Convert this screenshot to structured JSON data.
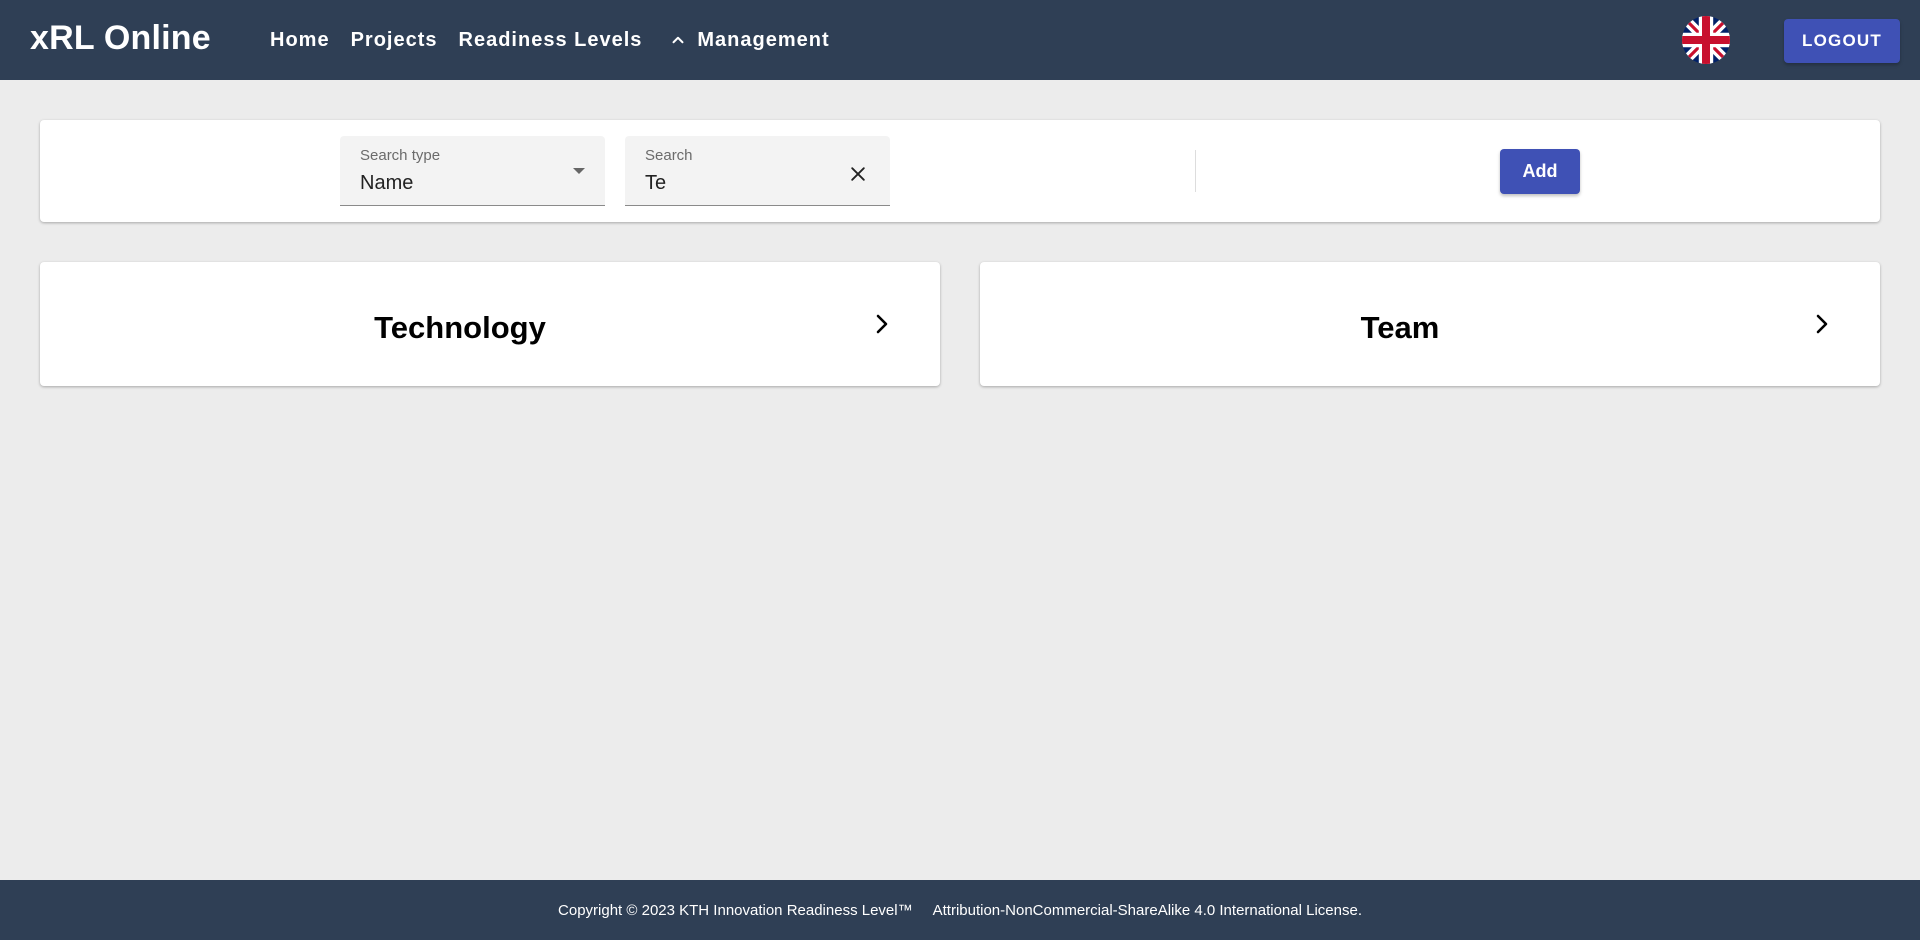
{
  "header": {
    "brand": "xRL Online",
    "nav": [
      {
        "label": "Home"
      },
      {
        "label": "Projects"
      },
      {
        "label": "Readiness Levels"
      },
      {
        "label": "Management",
        "icon": "chevron-up-icon"
      }
    ],
    "language_icon": "uk-flag-icon",
    "logout_label": "LOGOUT"
  },
  "search": {
    "type_label": "Search type",
    "type_value": "Name",
    "query_label": "Search",
    "query_value": "Te",
    "add_label": "Add"
  },
  "results": [
    {
      "title": "Technology",
      "icon": "chevron-right-icon"
    },
    {
      "title": "Team",
      "icon": "chevron-right-icon"
    }
  ],
  "footer": {
    "copyright": "Copyright © 2023 KTH Innovation Readiness Level™",
    "license": "Attribution-NonCommercial-ShareAlike 4.0 International License."
  },
  "colors": {
    "header_bg": "#2f3f55",
    "accent": "#3f51b5",
    "page_bg": "#ececec"
  }
}
